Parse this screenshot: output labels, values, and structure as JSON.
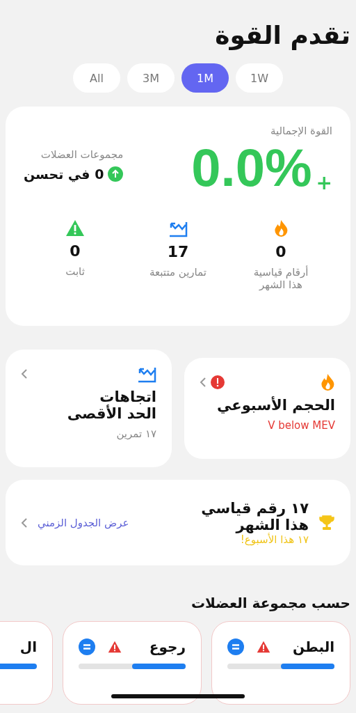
{
  "title": "تقدم القوة",
  "periods": [
    {
      "label": "1W",
      "selected": false
    },
    {
      "label": "1M",
      "selected": true
    },
    {
      "label": "3M",
      "selected": false
    },
    {
      "label": "All",
      "selected": false
    }
  ],
  "overview": {
    "label": "القوة الإجمالية",
    "sign": "+",
    "value": "0.0%",
    "muscle_label": "مجموعات العضلات",
    "improving": "0 في تحسن",
    "stats": [
      {
        "kind": "flame",
        "value": "0",
        "label": "أرقام قياسية\nهذا الشهر"
      },
      {
        "kind": "trend",
        "value": "17",
        "label": "تمارين متتبعة"
      },
      {
        "kind": "warning",
        "value": "0",
        "label": "ثابت"
      }
    ]
  },
  "tiles": [
    {
      "kind": "volume",
      "title": "الحجم الأسبوعي",
      "note": "V below MEV",
      "alert": true
    },
    {
      "kind": "trend",
      "title": "اتجاهات\nالحد الأقصى",
      "note": "١٧ تمرين",
      "alert": false
    }
  ],
  "records": {
    "title": "١٧ رقم قياسي\nهذا الشهر",
    "note": "١٧ هذا الأسبوع!",
    "link": "عرض الجدول الزمني"
  },
  "muscle_section": {
    "title": "حسب مجموعة العضلات",
    "groups": [
      {
        "name": "البطن",
        "warning": true,
        "level": 0.5
      },
      {
        "name": "رجوع",
        "warning": true,
        "level": 0.5
      },
      {
        "name": "ال"
      }
    ]
  }
}
